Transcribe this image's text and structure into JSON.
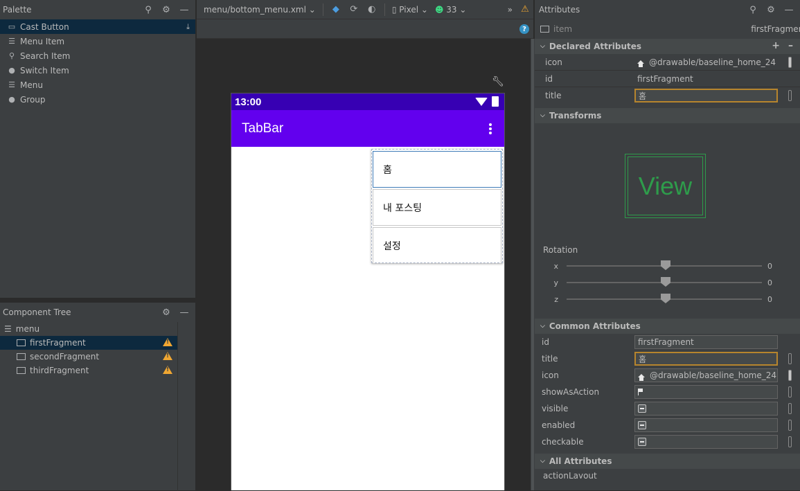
{
  "palette": {
    "title": "Palette",
    "items": [
      {
        "label": "Cast Button",
        "icon": "cast-icon",
        "selected": true
      },
      {
        "label": "Menu Item",
        "icon": "list-icon"
      },
      {
        "label": "Search Item",
        "icon": "search-icon"
      },
      {
        "label": "Switch Item",
        "icon": "switch-icon"
      },
      {
        "label": "Menu",
        "icon": "menu-icon"
      },
      {
        "label": "Group",
        "icon": "group-icon"
      }
    ]
  },
  "component_tree": {
    "title": "Component Tree",
    "root": "menu",
    "items": [
      {
        "label": "firstFragment",
        "selected": true,
        "warning": true
      },
      {
        "label": "secondFragment",
        "warning": true
      },
      {
        "label": "thirdFragment",
        "warning": true
      }
    ]
  },
  "editor": {
    "file_tab": "menu/bottom_menu.xml",
    "device": "Pixel",
    "api_level": "33",
    "overflow": "»",
    "phone": {
      "time": "13:00",
      "app_title": "TabBar",
      "menu_items": [
        "홈",
        "내 포스팅",
        "설정"
      ]
    }
  },
  "attributes": {
    "title": "Attributes",
    "element_type": "item",
    "element_id": "firstFragment",
    "declared": {
      "title": "Declared Attributes",
      "rows": [
        {
          "name": "icon",
          "value": "@drawable/baseline_home_24"
        },
        {
          "name": "id",
          "value": "firstFragment"
        },
        {
          "name": "title",
          "value": "홈"
        }
      ]
    },
    "transforms": {
      "title": "Transforms",
      "view_label": "View",
      "rotation_label": "Rotation",
      "sliders": [
        {
          "axis": "x",
          "value": "0"
        },
        {
          "axis": "y",
          "value": "0"
        },
        {
          "axis": "z",
          "value": "0"
        }
      ]
    },
    "common": {
      "title": "Common Attributes",
      "id_name": "id",
      "id_value": "firstFragment",
      "title_name": "title",
      "title_value": "홈",
      "icon_name": "icon",
      "icon_value": "@drawable/baseline_home_24",
      "show_as_action_name": "showAsAction",
      "visible_name": "visible",
      "enabled_name": "enabled",
      "checkable_name": "checkable"
    },
    "all": {
      "title": "All Attributes",
      "first_row": "actionLayout"
    }
  },
  "colors": {
    "status_bar": "#3700b3",
    "app_bar": "#6200ee",
    "warning": "#f0a732",
    "focus_border": "#b7852d",
    "view_preview": "#2e9c4b"
  }
}
